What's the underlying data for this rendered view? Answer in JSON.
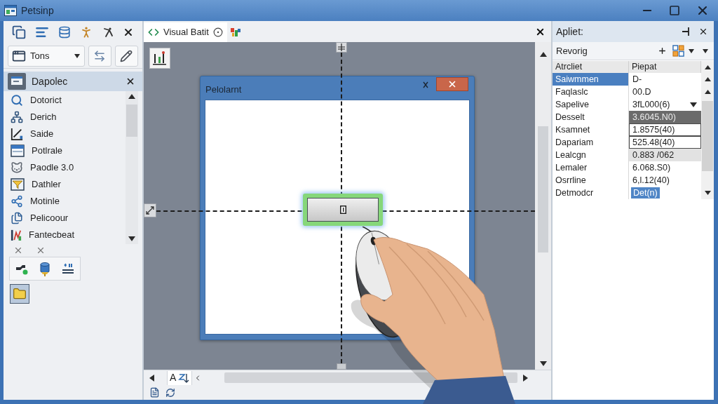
{
  "window": {
    "title": "Petsinp"
  },
  "toolbox": {
    "dropdown": "Tons",
    "group_title": "Dapolec",
    "items": [
      "Dotorict",
      "Derich",
      "Saide",
      "Potlrale",
      "Paodle 3.0",
      "Dathler",
      "Motinle",
      "Pelicoour",
      "Fantecbeat"
    ],
    "palette": [
      {
        "selected": true
      }
    ]
  },
  "editor": {
    "tabs": [
      {
        "label": "Visual Batit",
        "selected": true
      }
    ],
    "form": {
      "title": "Pelolarnt",
      "button": {
        "selected": true
      }
    },
    "scroll_label": "A"
  },
  "properties": {
    "title": "Apliet:",
    "object": "Revorig",
    "columns": [
      "Atrcliet",
      "Piepat"
    ],
    "rows": [
      {
        "name": "Saiwmmen",
        "value": "D-",
        "kind": "plain",
        "selected": true
      },
      {
        "name": "Faqlaslc",
        "value": "00.D",
        "kind": "plain",
        "selected": false
      },
      {
        "name": "Sapelive",
        "value": "3fL000(6)",
        "kind": "dropdown",
        "selected": false
      },
      {
        "name": "Desselt",
        "value": "3.6045.N0)",
        "kind": "dark",
        "selected": false
      },
      {
        "name": "Ksamnet",
        "value": "1.8575(40)",
        "kind": "boxed",
        "selected": false
      },
      {
        "name": "Dapariam",
        "value": "525.48(40)",
        "kind": "boxed",
        "selected": false
      },
      {
        "name": "Lealcgn",
        "value": "0.883 /062",
        "kind": "shaded",
        "selected": false
      },
      {
        "name": "Lemaler",
        "value": "6.068.S0)",
        "kind": "plain",
        "selected": false
      },
      {
        "name": "Osrrline",
        "value": "6,l.12(40)",
        "kind": "plain",
        "selected": false
      },
      {
        "name": "Detmodcr",
        "value": "Det(n)",
        "kind": "chip",
        "selected": false
      }
    ]
  }
}
